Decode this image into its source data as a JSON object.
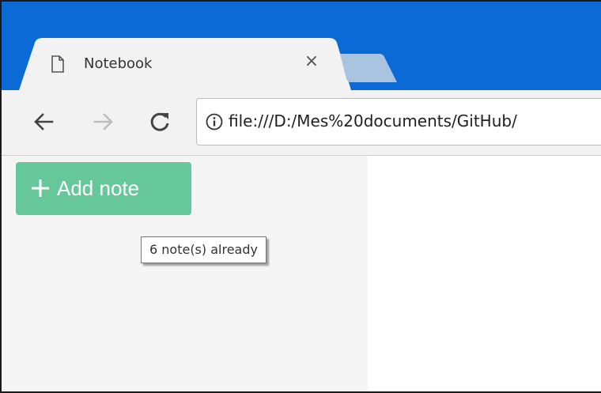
{
  "browser": {
    "tab": {
      "title": "Notebook",
      "close_glyph": "×",
      "icon": "page-icon"
    },
    "new_tab_icon": "new-tab-icon",
    "toolbar": {
      "back_icon": "back-arrow-icon",
      "forward_icon": "forward-arrow-icon",
      "reload_icon": "reload-icon"
    },
    "address_bar": {
      "icon": "info-icon",
      "url": "file:///D:/Mes%20documents/GitHub/"
    }
  },
  "app": {
    "add_note_button": {
      "label": "Add note",
      "icon": "plus-icon"
    },
    "tooltip": "6 note(s) already"
  },
  "colors": {
    "titlebar": "#0b6ad6",
    "accent_button": "#66c79b",
    "sidebar_bg": "#f5f5f5"
  }
}
